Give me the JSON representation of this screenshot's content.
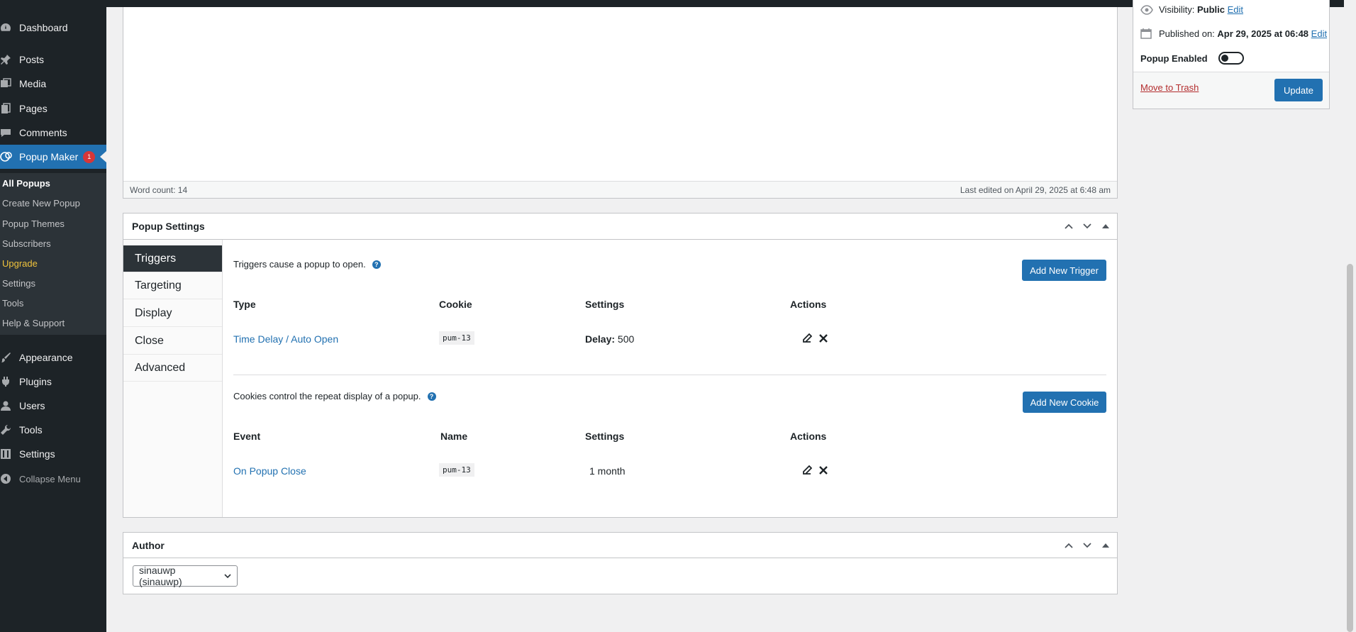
{
  "sidebar": {
    "items": [
      {
        "label": "Dashboard",
        "icon": "dashboard-icon"
      },
      {
        "label": "Posts",
        "icon": "pin-icon"
      },
      {
        "label": "Media",
        "icon": "media-icon"
      },
      {
        "label": "Pages",
        "icon": "pages-icon"
      },
      {
        "label": "Comments",
        "icon": "comment-icon"
      },
      {
        "label": "Popup Maker",
        "icon": "popup-maker-icon",
        "badge": "1"
      },
      {
        "label": "Appearance",
        "icon": "paintbrush-icon"
      },
      {
        "label": "Plugins",
        "icon": "plugin-icon"
      },
      {
        "label": "Users",
        "icon": "user-icon"
      },
      {
        "label": "Tools",
        "icon": "wrench-icon"
      },
      {
        "label": "Settings",
        "icon": "settings-icon"
      },
      {
        "label": "Collapse Menu",
        "icon": "collapse-icon"
      }
    ],
    "submenu": [
      "All Popups",
      "Create New Popup",
      "Popup Themes",
      "Subscribers",
      "Upgrade",
      "Settings",
      "Tools",
      "Help & Support"
    ]
  },
  "editor": {
    "word_count": "Word count: 14",
    "last_edited": "Last edited on April 29, 2025 at 6:48 am"
  },
  "publish": {
    "visibility_label": "Visibility:",
    "visibility_value": "Public",
    "published_label": "Published on:",
    "published_value": "Apr 29, 2025 at 06:48",
    "edit": "Edit",
    "popup_enabled": "Popup Enabled",
    "popup_enabled_state": false,
    "trash": "Move to Trash",
    "update": "Update"
  },
  "popup_settings": {
    "title": "Popup Settings",
    "tabs": [
      "Triggers",
      "Targeting",
      "Display",
      "Close",
      "Advanced"
    ],
    "active_tab": "Triggers",
    "triggers": {
      "desc": "Triggers cause a popup to open.",
      "add_button": "Add New Trigger",
      "headers": [
        "Type",
        "Cookie",
        "Settings",
        "Actions"
      ],
      "rows": [
        {
          "type": "Time Delay / Auto Open",
          "cookie": "pum-13",
          "settings_label": "Delay:",
          "settings_value": "500"
        }
      ]
    },
    "cookies": {
      "desc": "Cookies control the repeat display of a popup.",
      "add_button": "Add New Cookie",
      "headers": [
        "Event",
        "Name",
        "Settings",
        "Actions"
      ],
      "rows": [
        {
          "event": "On Popup Close",
          "name": "pum-13",
          "settings": "1 month"
        }
      ]
    }
  },
  "author": {
    "title": "Author",
    "selected": "sinauwp (sinauwp)"
  },
  "colors": {
    "sidebar_bg": "#1d2327",
    "submenu_bg": "#2c3338",
    "accent": "#2271b1",
    "badge": "#d63638",
    "trash": "#b32d2e"
  }
}
